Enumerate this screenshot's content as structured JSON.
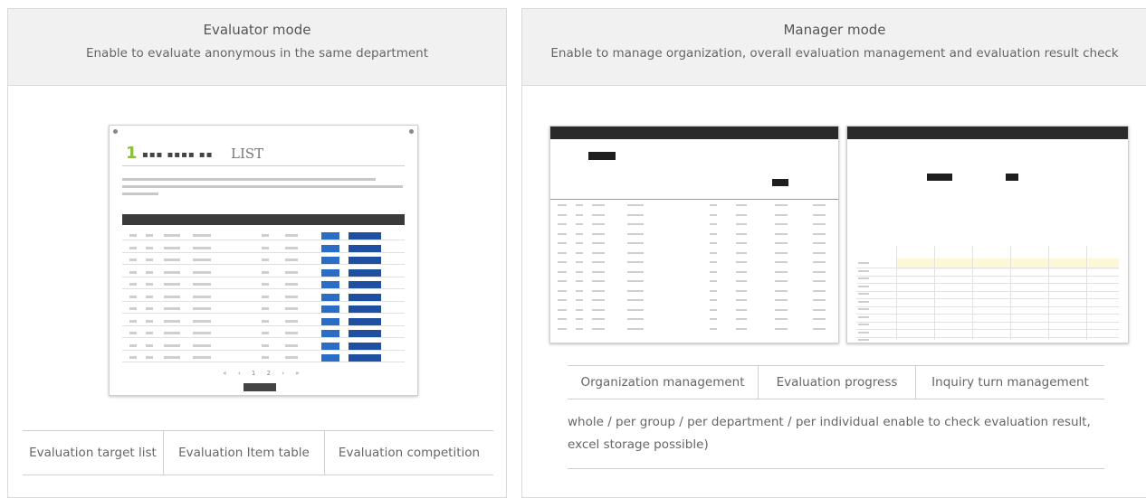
{
  "evaluator": {
    "title": "Evaluator mode",
    "subtitle": "Enable to evaluate anonymous in the same department",
    "screenshot": {
      "number": "1",
      "heading_text": "LIST"
    },
    "tabs": [
      "Evaluation target list",
      "Evaluation Item table",
      "Evaluation competition"
    ]
  },
  "manager": {
    "title": "Manager mode",
    "subtitle": "Enable to manage organization, overall evaluation management and evaluation result check",
    "tabs": [
      "Organization management",
      "Evaluation progress",
      "Inquiry turn management"
    ],
    "description": "whole / per group / per department / per individual enable to check evaluation result, excel storage possible)"
  },
  "colors": {
    "accent_green": "#8cbe3c",
    "button_blue": "#2b6cc4",
    "header_bg": "#f1f1f1"
  }
}
